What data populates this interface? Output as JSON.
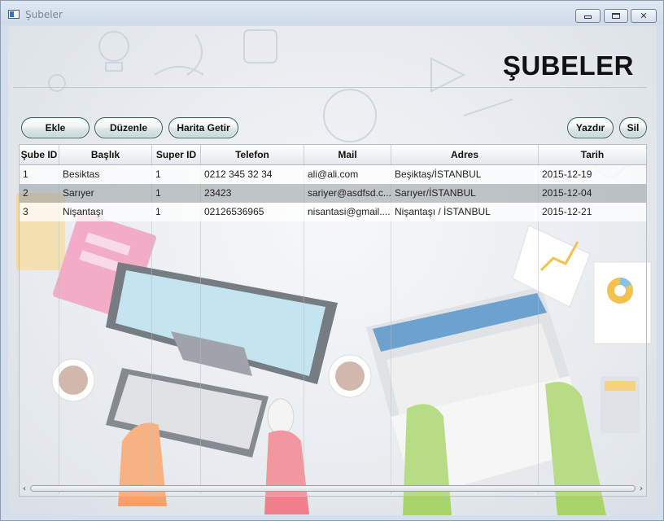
{
  "window": {
    "title": "Şubeler"
  },
  "header": {
    "title": "ŞUBELER"
  },
  "toolbar": {
    "add_label": "Ekle",
    "edit_label": "Düzenle",
    "map_label": "Harita Getir",
    "print_label": "Yazdır",
    "delete_label": "Sil"
  },
  "table": {
    "columns": [
      "Şube ID",
      "Başlık",
      "Super ID",
      "Telefon",
      "Mail",
      "Adres",
      "Tarih"
    ],
    "rows": [
      [
        "1",
        "Besiktas",
        "1",
        "0212 345 32 34",
        "ali@ali.com",
        "Beşiktaş/İSTANBUL",
        "2015-12-19"
      ],
      [
        "2",
        "Sarıyer",
        "1",
        "23423",
        "sariyer@asdfsd.c...",
        "Sarıyer/İSTANBUL",
        "2015-12-04"
      ],
      [
        "3",
        "Nişantaşı",
        "1",
        "02126536965",
        "nisantasi@gmail....",
        "Nişantaşı / İSTANBUL",
        "2015-12-21"
      ]
    ],
    "selected_row": 2
  },
  "icons": {
    "window_icon": "app-window-icon",
    "minimize": "minimize-icon",
    "maximize": "maximize-icon",
    "close": "close-icon",
    "scroll_left": "chevron-left-icon",
    "scroll_right": "chevron-right-icon"
  },
  "colors": {
    "button_border": "#3f5f5a",
    "selected_row": "#9aa0a4",
    "title_text": "#111111"
  }
}
